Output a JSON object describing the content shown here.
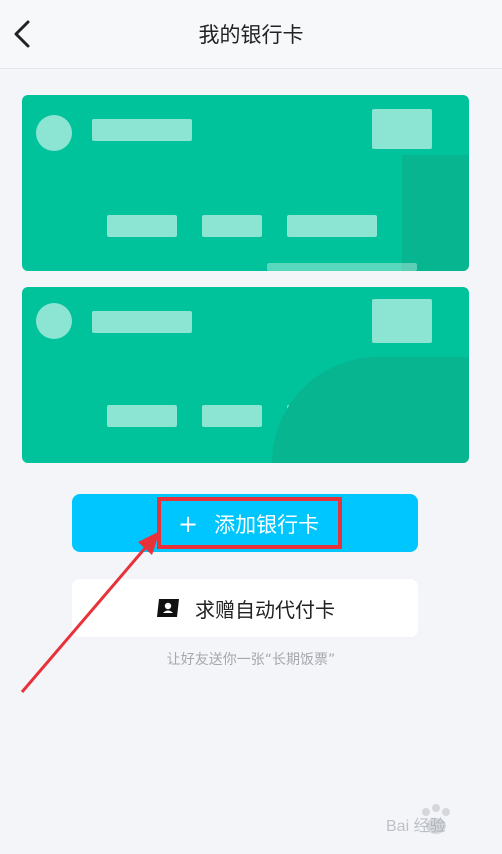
{
  "header": {
    "title": "我的银行卡",
    "back_icon": "chevron-left-icon"
  },
  "cards": [
    {
      "brand_color": "#00c39c"
    },
    {
      "brand_color": "#00c39c"
    }
  ],
  "add_button": {
    "label": "添加银行卡",
    "icon": "plus-icon",
    "color": "#00c6ff",
    "highlight_color": "#e8323a"
  },
  "gift_button": {
    "label": "求赠自动代付卡",
    "icon": "gift-card-icon"
  },
  "hint": "让好友送你一张“长期饭票”",
  "watermark": {
    "text": "Bai 经验"
  }
}
